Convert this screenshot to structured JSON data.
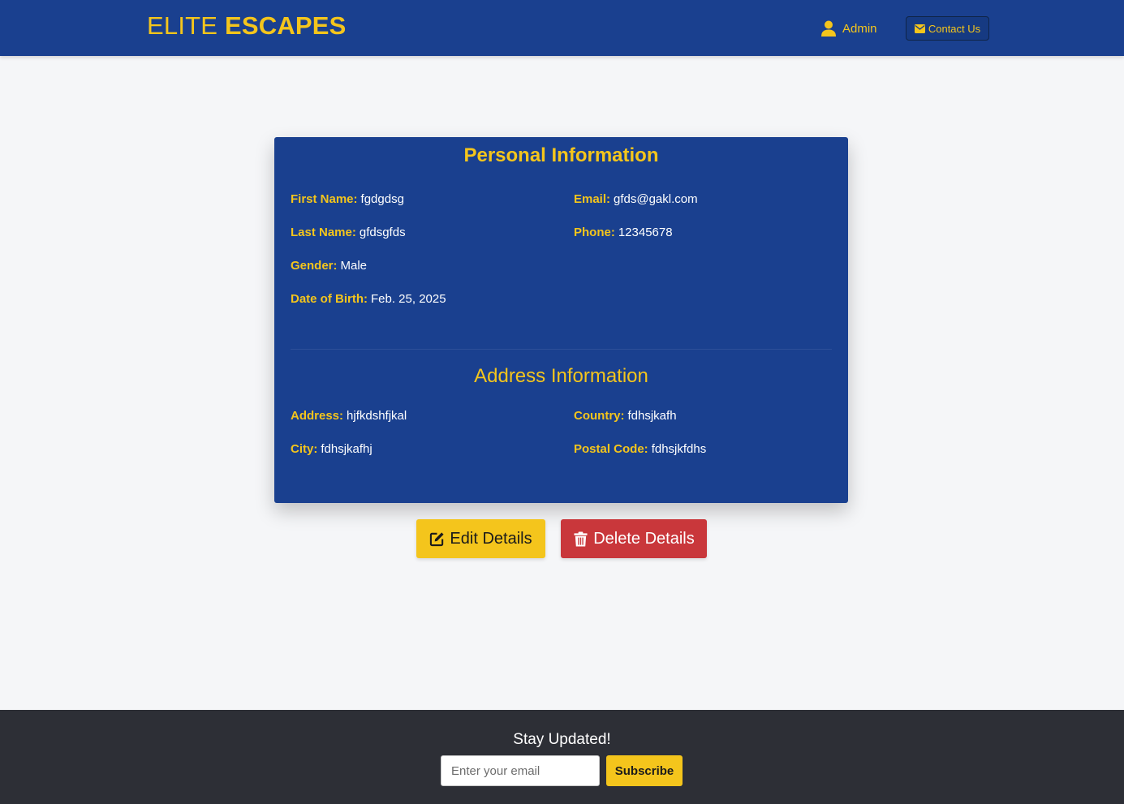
{
  "header": {
    "brand_part1": "ELITE",
    "brand_part2": "ESCAPES",
    "admin_label": "Admin",
    "contact_label": "Contact Us"
  },
  "personal": {
    "title": "Personal Information",
    "first_name": {
      "label": "First Name:",
      "value": "fgdgdsg"
    },
    "last_name": {
      "label": "Last Name:",
      "value": "gfdsgfds"
    },
    "gender": {
      "label": "Gender:",
      "value": "Male"
    },
    "dob": {
      "label": "Date of Birth:",
      "value": "Feb. 25, 2025"
    },
    "email": {
      "label": "Email:",
      "value": "gfds@gakl.com"
    },
    "phone": {
      "label": "Phone:",
      "value": "12345678"
    }
  },
  "address": {
    "title": "Address Information",
    "address": {
      "label": "Address:",
      "value": "hjfkdshfjkal"
    },
    "city": {
      "label": "City:",
      "value": "fdhsjkafhj"
    },
    "country": {
      "label": "Country:",
      "value": "fdhsjkafh"
    },
    "postal_code": {
      "label": "Postal Code:",
      "value": "fdhsjkfdhs"
    }
  },
  "actions": {
    "edit_label": "Edit Details",
    "delete_label": "Delete Details"
  },
  "footer": {
    "title": "Stay Updated!",
    "email_placeholder": "Enter your email",
    "subscribe_label": "Subscribe"
  },
  "colors": {
    "primary": "#1a408f",
    "accent": "#f4c51c",
    "danger": "#c9373b",
    "footer": "#2d2f36"
  }
}
